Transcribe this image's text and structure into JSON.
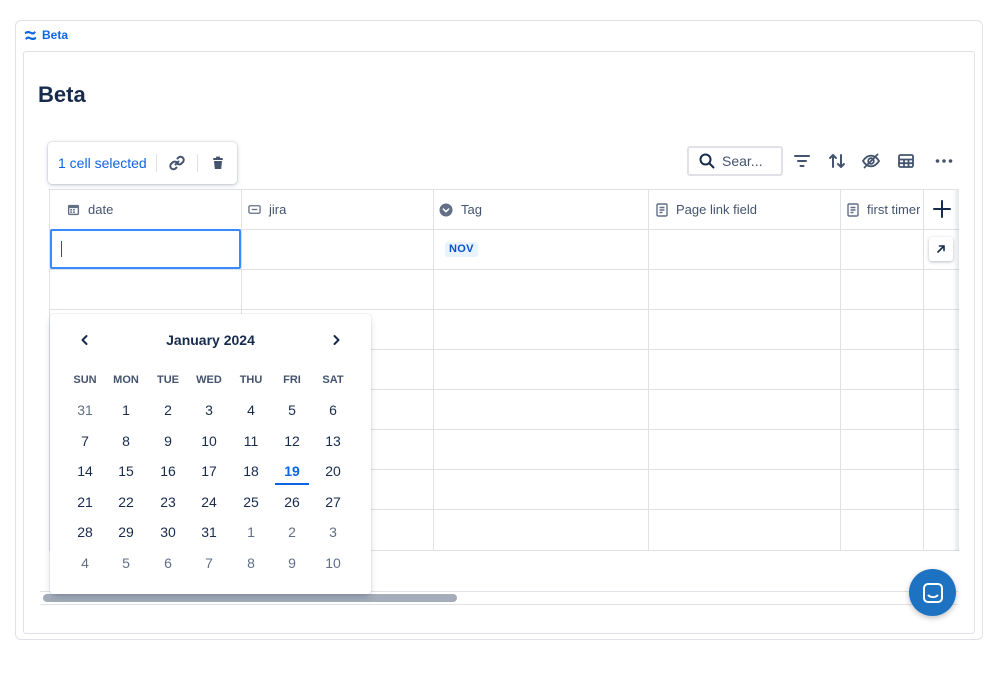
{
  "breadcrumb": {
    "label": "Beta",
    "icon": "confluence-logo-icon"
  },
  "page": {
    "title": "Beta"
  },
  "selection_toolbar": {
    "count_label": "1 cell selected",
    "icons": [
      "link-icon",
      "trash-icon"
    ]
  },
  "toolbar": {
    "search_placeholder": "Sear...",
    "icons": [
      "search-icon",
      "filter-icon",
      "sort-icon",
      "hide-icon",
      "table-view-icon",
      "more-icon"
    ]
  },
  "columns": [
    {
      "label": "date",
      "icon": "calendar-icon"
    },
    {
      "label": "jira",
      "icon": "jira-link-icon"
    },
    {
      "label": "Tag",
      "icon": "tag-icon"
    },
    {
      "label": "Page link field",
      "icon": "page-icon"
    },
    {
      "label": "first timer",
      "icon": "page-icon"
    }
  ],
  "rows": [
    {
      "date": "",
      "jira": "",
      "tag": "NOV",
      "page_link": "",
      "first_timer": ""
    }
  ],
  "calendar": {
    "month_label": "January 2024",
    "weekdays": [
      "SUN",
      "MON",
      "TUE",
      "WED",
      "THU",
      "FRI",
      "SAT"
    ],
    "weeks": [
      [
        {
          "d": "31",
          "o": true
        },
        {
          "d": "1"
        },
        {
          "d": "2"
        },
        {
          "d": "3"
        },
        {
          "d": "4"
        },
        {
          "d": "5"
        },
        {
          "d": "6"
        }
      ],
      [
        {
          "d": "7"
        },
        {
          "d": "8"
        },
        {
          "d": "9"
        },
        {
          "d": "10"
        },
        {
          "d": "11"
        },
        {
          "d": "12"
        },
        {
          "d": "13"
        }
      ],
      [
        {
          "d": "14"
        },
        {
          "d": "15"
        },
        {
          "d": "16"
        },
        {
          "d": "17"
        },
        {
          "d": "18"
        },
        {
          "d": "19",
          "today": true
        },
        {
          "d": "20"
        }
      ],
      [
        {
          "d": "21"
        },
        {
          "d": "22"
        },
        {
          "d": "23"
        },
        {
          "d": "24"
        },
        {
          "d": "25"
        },
        {
          "d": "26"
        },
        {
          "d": "27"
        }
      ],
      [
        {
          "d": "28"
        },
        {
          "d": "29"
        },
        {
          "d": "30"
        },
        {
          "d": "31"
        },
        {
          "d": "1",
          "o": true
        },
        {
          "d": "2",
          "o": true
        },
        {
          "d": "3",
          "o": true
        }
      ],
      [
        {
          "d": "4",
          "o": true
        },
        {
          "d": "5",
          "o": true
        },
        {
          "d": "6",
          "o": true
        },
        {
          "d": "7",
          "o": true
        },
        {
          "d": "8",
          "o": true
        },
        {
          "d": "9",
          "o": true
        },
        {
          "d": "10",
          "o": true
        }
      ]
    ]
  },
  "colors": {
    "accent": "#0c66e4",
    "focus_border": "#388bff",
    "tag_bg": "#e9f2ff",
    "chat_button": "#1d72c2"
  }
}
